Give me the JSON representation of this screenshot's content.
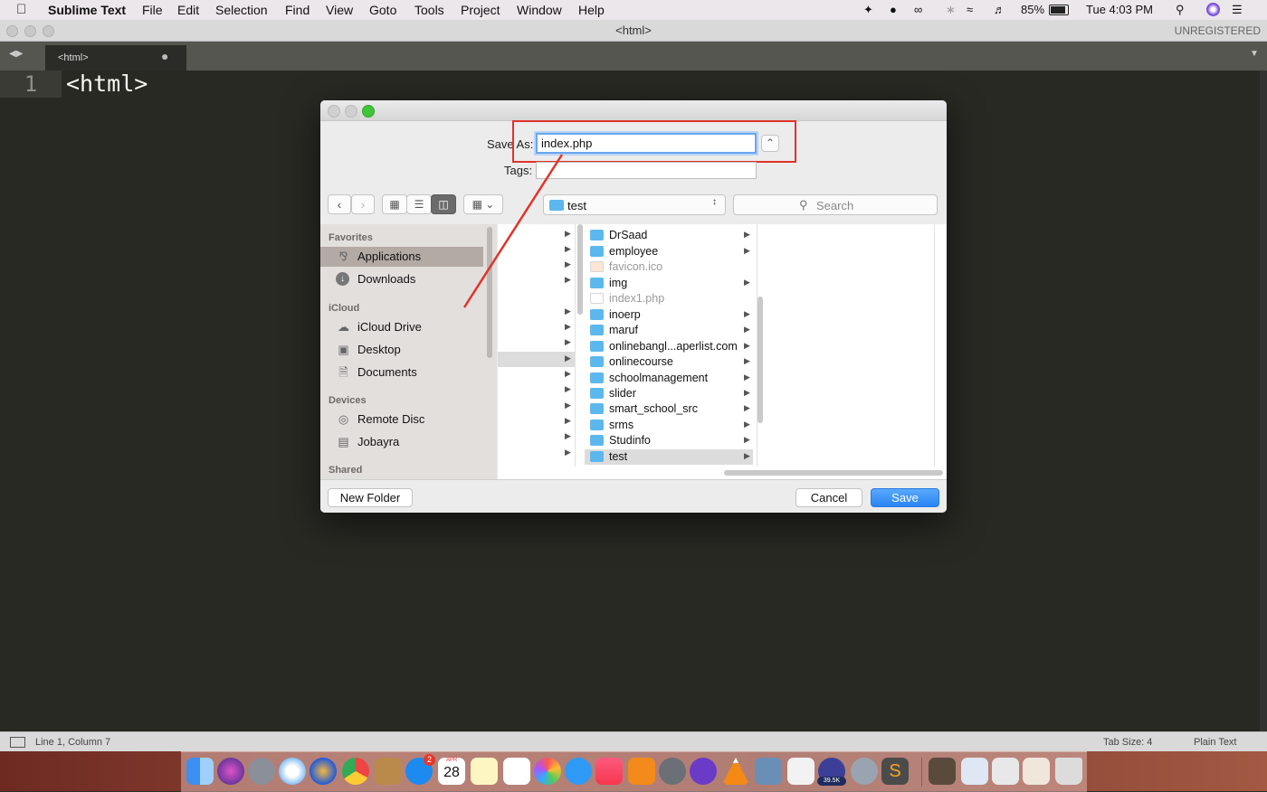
{
  "menubar": {
    "app_name": "Sublime Text",
    "items": [
      "File",
      "Edit",
      "Selection",
      "Find",
      "View",
      "Goto",
      "Tools",
      "Project",
      "Window",
      "Help"
    ],
    "battery": "85%",
    "clock": "Tue 4:03 PM"
  },
  "window": {
    "title": "<html>",
    "registration": "UNREGISTERED",
    "tab_label": "<html>"
  },
  "editor": {
    "line_number": "1",
    "code": "<html>"
  },
  "status": {
    "position": "Line 1, Column 7",
    "tab_size": "Tab Size: 4",
    "syntax": "Plain Text"
  },
  "dialog": {
    "save_as_label": "Save As:",
    "filename": "index.php",
    "tags_label": "Tags:",
    "location": "test",
    "search_placeholder": "Search",
    "sidebar": {
      "favorites_header": "Favorites",
      "favorites": [
        "Applications",
        "Downloads"
      ],
      "icloud_header": "iCloud",
      "icloud": [
        "iCloud Drive",
        "Desktop",
        "Documents"
      ],
      "devices_header": "Devices",
      "devices": [
        "Remote Disc",
        "Jobayra"
      ],
      "shared_header": "Shared"
    },
    "files": [
      {
        "name": "DrSaad",
        "kind": "folder"
      },
      {
        "name": "employee",
        "kind": "folder"
      },
      {
        "name": "favicon.ico",
        "kind": "file"
      },
      {
        "name": "img",
        "kind": "folder"
      },
      {
        "name": "index1.php",
        "kind": "file"
      },
      {
        "name": "inoerp",
        "kind": "folder"
      },
      {
        "name": "maruf",
        "kind": "folder"
      },
      {
        "name": "onlinebangl...aperlist.com",
        "kind": "folder"
      },
      {
        "name": "onlinecourse",
        "kind": "folder"
      },
      {
        "name": "schoolmanagement",
        "kind": "folder"
      },
      {
        "name": "slider",
        "kind": "folder"
      },
      {
        "name": "smart_school_src",
        "kind": "folder"
      },
      {
        "name": "srms",
        "kind": "folder"
      },
      {
        "name": "Studinfo",
        "kind": "folder"
      },
      {
        "name": "test",
        "kind": "folder"
      }
    ],
    "new_folder_label": "New Folder",
    "cancel_label": "Cancel",
    "save_label": "Save"
  },
  "dock": {
    "calendar_month": "APR",
    "calendar_day": "28",
    "appstore_badge": "2",
    "network_badge": "39.5K"
  },
  "colors": {
    "editor_bg": "#282923",
    "highlight_red": "#e0332b",
    "save_button_blue": "#2a86f5",
    "folder_blue": "#5cb8ec"
  }
}
